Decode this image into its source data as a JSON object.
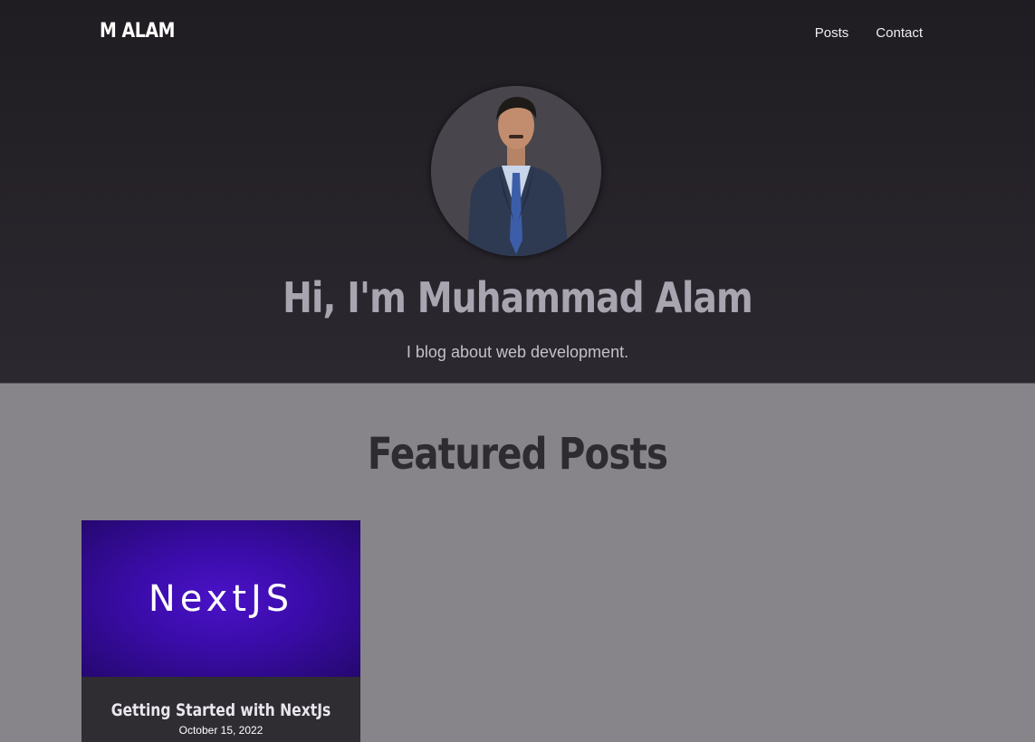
{
  "nav": {
    "logo": "M ALAM",
    "links": [
      "Posts",
      "Contact"
    ]
  },
  "hero": {
    "title": "Hi, I'm Muhammad Alam",
    "subtitle": "I blog about web development."
  },
  "featured": {
    "title": "Featured Posts",
    "posts": [
      {
        "image_text": "NextJS",
        "title": "Getting Started with NextJs",
        "date": "October 15, 2022"
      }
    ]
  },
  "colors": {
    "hero_bg": "#232027",
    "page_bg": "#87848a",
    "card_bg": "#2f2c32",
    "post_image_bg": "#3a0ca8"
  }
}
